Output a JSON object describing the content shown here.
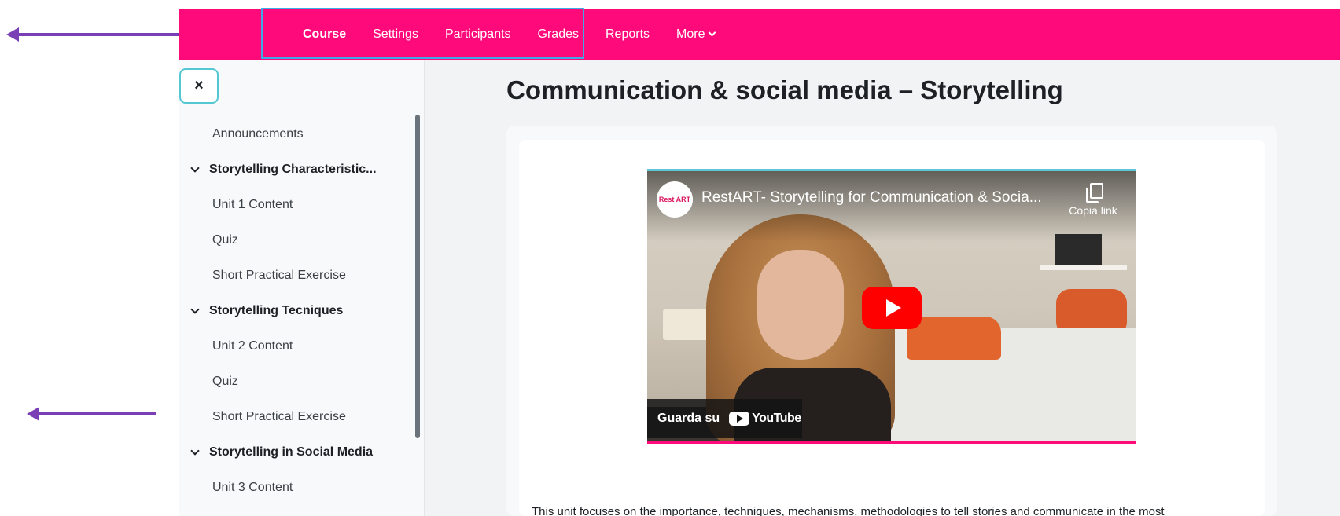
{
  "navbar": {
    "items": [
      {
        "label": "Course",
        "active": true
      },
      {
        "label": "Settings"
      },
      {
        "label": "Participants"
      },
      {
        "label": "Grades"
      },
      {
        "label": "Reports"
      },
      {
        "label": "More"
      }
    ],
    "more_icon": "chevron-down-icon",
    "bg_color": "#ff0a7a"
  },
  "sidebar": {
    "close_label": "×",
    "items": [
      {
        "label": "Announcements",
        "type": "link"
      },
      {
        "label": "Storytelling Characteristic...",
        "type": "section"
      },
      {
        "label": "Unit 1 Content",
        "type": "link"
      },
      {
        "label": "Quiz",
        "type": "link"
      },
      {
        "label": "Short Practical Exercise",
        "type": "link"
      },
      {
        "label": "Storytelling Tecniques",
        "type": "section"
      },
      {
        "label": "Unit 2 Content",
        "type": "link"
      },
      {
        "label": "Quiz",
        "type": "link"
      },
      {
        "label": "Short Practical Exercise",
        "type": "link"
      },
      {
        "label": "Storytelling in Social Media",
        "type": "section"
      },
      {
        "label": "Unit 3 Content",
        "type": "link"
      }
    ]
  },
  "main": {
    "title": "Communication & social media – Storytelling",
    "video": {
      "channel_logo": "Rest ART",
      "title": "RestART- Storytelling for Communication & Socia...",
      "copy_label": "Copia link",
      "watch_label": "Guarda su",
      "platform": "YouTube"
    },
    "body_text": "This unit focuses on the importance, techniques, mechanisms, methodologies to tell stories and communicate in the most"
  },
  "colors": {
    "accent": "#ff0a7a",
    "highlight": "#3fa9e6",
    "annotation_arrow": "#7a3fb5"
  }
}
